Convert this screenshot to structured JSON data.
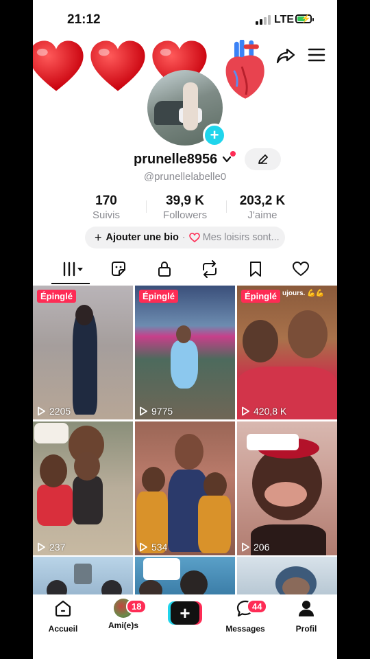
{
  "status": {
    "time": "21:12",
    "network": "LTE"
  },
  "profile": {
    "username": "prunelle8956",
    "handle": "@prunellelabelle0",
    "stats": [
      {
        "value": "170",
        "label": "Suivis"
      },
      {
        "value": "39,9 K",
        "label": "Followers"
      },
      {
        "value": "203,2 K",
        "label": "J'aime"
      }
    ],
    "bio": {
      "add_label": "Ajouter une bio",
      "separator": "·",
      "hobbies": "Mes loisirs sont..."
    }
  },
  "icons": {
    "stickers": [
      "red-heart-emoji",
      "red-heart-emoji",
      "red-heart-emoji",
      "anatomical-heart-emoji"
    ],
    "tabs": [
      "grid-icon",
      "sticker-icon",
      "lock-icon",
      "repost-icon",
      "bookmark-icon",
      "heart-outline-icon"
    ]
  },
  "videos": [
    {
      "pinned": "Épinglé",
      "views": "2205"
    },
    {
      "pinned": "Épinglé",
      "views": "9775"
    },
    {
      "pinned": "Épinglé",
      "views": "420,8 K",
      "overlay": "ujours. 💪💪"
    },
    {
      "views": "237"
    },
    {
      "views": "534"
    },
    {
      "views": "206"
    },
    {},
    {},
    {}
  ],
  "nav": {
    "home": "Accueil",
    "friends": "Ami(e)s",
    "friends_badge": "18",
    "messages": "Messages",
    "messages_badge": "44",
    "profile": "Profil"
  },
  "colors": {
    "accent": "#fe2c55",
    "cyan": "#20d5ec",
    "text": "#111111",
    "muted": "#8a8b91"
  }
}
